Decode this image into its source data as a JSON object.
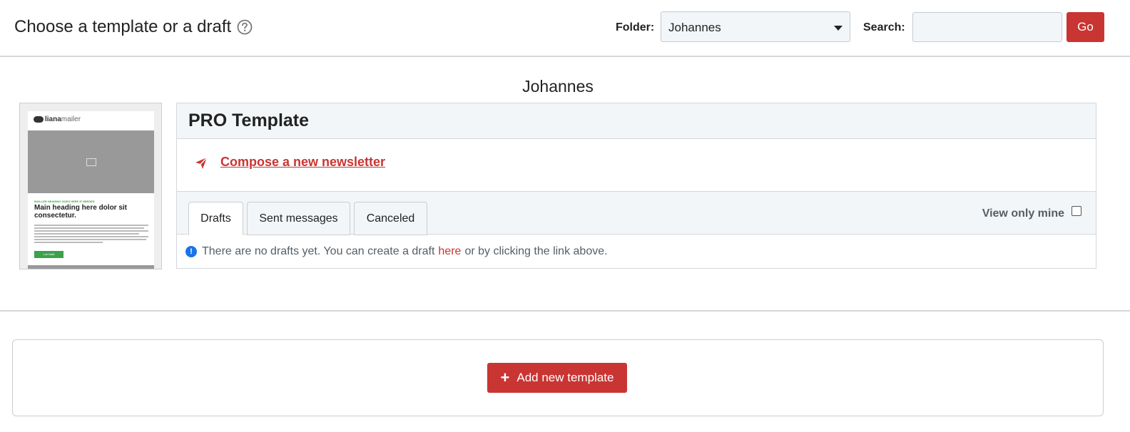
{
  "header": {
    "title": "Choose a template or a draft",
    "folder_label": "Folder:",
    "folder_value": "Johannes",
    "search_label": "Search:",
    "search_value": "",
    "go_label": "Go"
  },
  "folder_heading": "Johannes",
  "thumbnail": {
    "logo_bold": "liana",
    "logo_light": "mailer",
    "kicker": "MAILLER HEADING GOES HERE IF NEEDED",
    "main_heading": "Main heading here dolor sit consectetur.",
    "cta": "Lue lisää"
  },
  "template": {
    "name": "PRO Template",
    "compose_label": "Compose a new newsletter",
    "tabs": [
      {
        "label": "Drafts",
        "active": true
      },
      {
        "label": "Sent messages",
        "active": false
      },
      {
        "label": "Canceled",
        "active": false
      }
    ],
    "view_only_mine_label": "View only mine",
    "view_only_mine_checked": false,
    "notice_before": "There are no drafts yet. You can create a draft",
    "notice_link": "here",
    "notice_after": "or by clicking the link above."
  },
  "add_template_label": "Add new template",
  "colors": {
    "accent": "#c93533",
    "info": "#1a73e8",
    "panel_bg": "#f3f6f8"
  },
  "icons": {
    "help": "question-circle-icon",
    "compose": "paper-plane-icon",
    "info": "info-circle-icon",
    "add": "plus-icon",
    "dropdown": "caret-down-icon"
  }
}
